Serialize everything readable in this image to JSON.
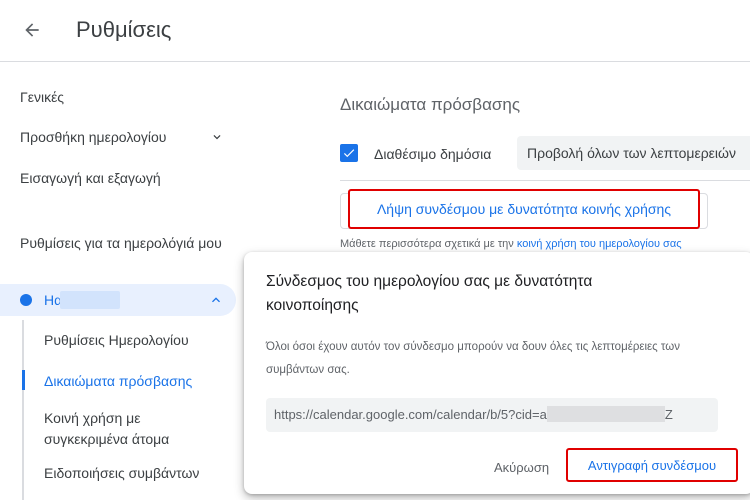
{
  "header": {
    "title": "Ρυθμίσεις",
    "back_icon": "arrow-back-icon"
  },
  "sidebar": {
    "general": "Γενικές",
    "add_calendar": "Προσθήκη ημερολογίου",
    "import_export": "Εισαγωγή και εξαγωγή",
    "my_calendars_header": "Ρυθμίσεις για τα ημερολόγιά μου",
    "calendar_name": "Ηα",
    "sub_items": [
      {
        "label": "Ρυθμίσεις Ημερολογίου"
      },
      {
        "label": "Δικαιώματα πρόσβασης",
        "active": true
      },
      {
        "label": "Κοινή χρήση με συγκεκριμένα άτομα"
      },
      {
        "label": "Ειδοποιήσεις συμβάντων"
      }
    ]
  },
  "main": {
    "section_title": "Δικαιώματα πρόσβασης",
    "public_label": "Διαθέσιμο δημόσια",
    "public_checked": true,
    "visibility_select": "Προβολή όλων των λεπτομερειών",
    "share_link_button": "Λήψη συνδέσμου με δυνατότητα κοινής χρήσης",
    "learn_more_prefix": "Μάθετε περισσότερα σχετικά με την ",
    "learn_more_link": "κοινή χρήση του ημερολογίου σας"
  },
  "dialog": {
    "title": "Σύνδεσμος του ημερολογίου σας με δυνατότητα κοινοποίησης",
    "description": "Όλοι όσοι έχουν αυτόν τον σύνδεσμο μπορούν να δουν όλες τις λεπτομέρειες των συμβάντων σας.",
    "url_prefix": "https://calendar.google.com/calendar/b/5?cid=a",
    "url_suffix": "Z",
    "cancel": "Ακύρωση",
    "copy": "Αντιγραφή συνδέσμου"
  },
  "colors": {
    "accent": "#1a73e8",
    "highlight": "#e00000"
  }
}
